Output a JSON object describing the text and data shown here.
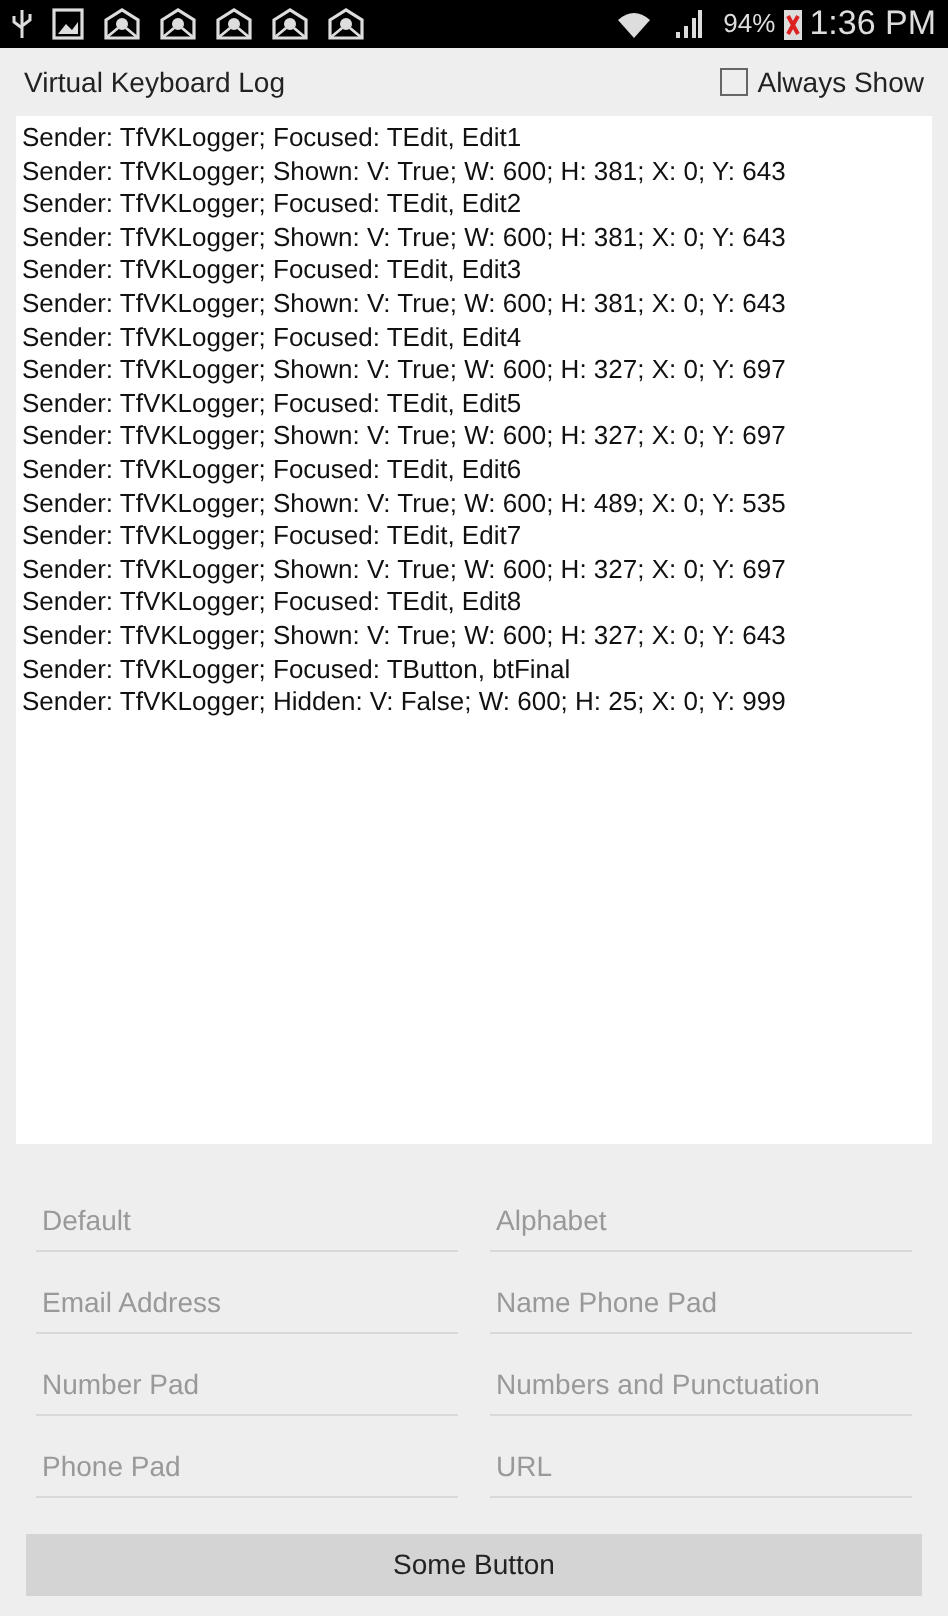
{
  "status_bar": {
    "battery": "94%",
    "time": "1:36 PM"
  },
  "header": {
    "title": "Virtual Keyboard Log",
    "always_show": {
      "label": "Always Show",
      "checked": false
    }
  },
  "log": [
    "Sender: TfVKLogger; Focused: TEdit, Edit1",
    "Sender: TfVKLogger; Shown: V: True; W: 600; H: 381; X: 0; Y: 643",
    "Sender: TfVKLogger; Focused: TEdit, Edit2",
    "Sender: TfVKLogger; Shown: V: True; W: 600; H: 381; X: 0; Y: 643",
    "Sender: TfVKLogger; Focused: TEdit, Edit3",
    "Sender: TfVKLogger; Shown: V: True; W: 600; H: 381; X: 0; Y: 643",
    "Sender: TfVKLogger; Focused: TEdit, Edit4",
    "Sender: TfVKLogger; Shown: V: True; W: 600; H: 327; X: 0; Y: 697",
    "Sender: TfVKLogger; Focused: TEdit, Edit5",
    "Sender: TfVKLogger; Shown: V: True; W: 600; H: 327; X: 0; Y: 697",
    "Sender: TfVKLogger; Focused: TEdit, Edit6",
    "Sender: TfVKLogger; Shown: V: True; W: 600; H: 489; X: 0; Y: 535",
    "Sender: TfVKLogger; Focused: TEdit, Edit7",
    "Sender: TfVKLogger; Shown: V: True; W: 600; H: 327; X: 0; Y: 697",
    "Sender: TfVKLogger; Focused: TEdit, Edit8",
    "Sender: TfVKLogger; Shown: V: True; W: 600; H: 327; X: 0; Y: 643",
    "Sender: TfVKLogger; Focused: TButton, btFinal",
    "Sender: TfVKLogger; Hidden: V: False; W: 600; H: 25; X: 0; Y: 999"
  ],
  "fields": [
    {
      "placeholder": "Default"
    },
    {
      "placeholder": "Alphabet"
    },
    {
      "placeholder": "Email Address"
    },
    {
      "placeholder": "Name Phone Pad"
    },
    {
      "placeholder": "Number Pad"
    },
    {
      "placeholder": "Numbers and Punctuation"
    },
    {
      "placeholder": "Phone Pad"
    },
    {
      "placeholder": "URL"
    }
  ],
  "button": {
    "label": "Some Button"
  }
}
